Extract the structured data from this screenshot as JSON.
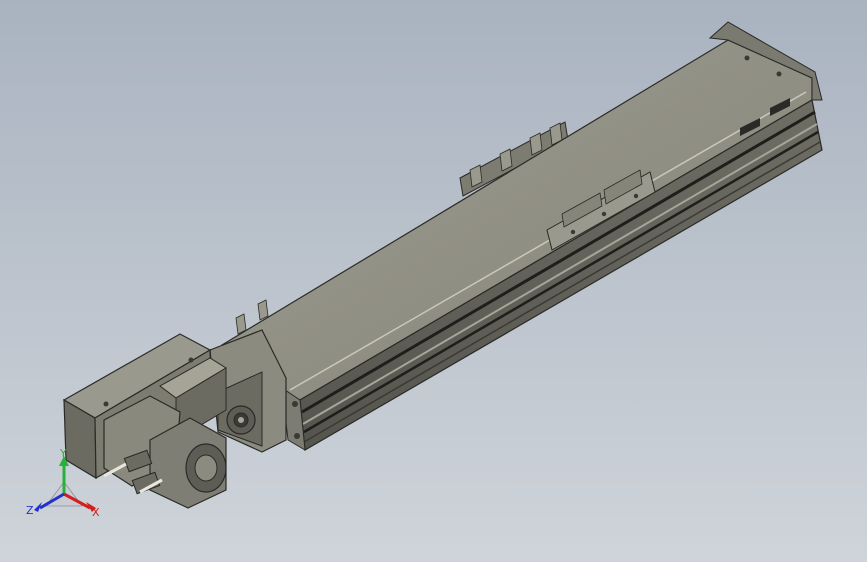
{
  "viewport": {
    "background_top": "#a9b3c0",
    "background_bottom": "#cfd4da"
  },
  "model": {
    "body_color": "#8e8e80",
    "edge_color": "#2a2a26"
  },
  "triad": {
    "x_label": "X",
    "y_label": "Y",
    "z_label": "Z",
    "x_color": "#d41d1d",
    "y_color": "#27b03a",
    "z_color": "#2231c9"
  }
}
